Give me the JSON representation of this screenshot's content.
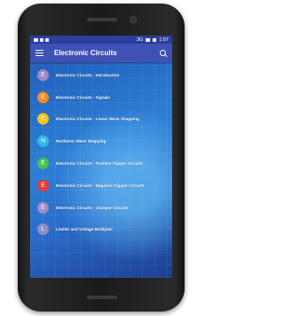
{
  "status_bar": {
    "signal_text": "3G",
    "time": "1:07"
  },
  "app_bar": {
    "title": "Electronic Circuits",
    "menu_icon": "menu-icon",
    "search_icon": "search-icon"
  },
  "items": [
    {
      "letter": "E",
      "label": "Electronic Circuits - Introduction",
      "color": "#9e86c9"
    },
    {
      "letter": "E",
      "label": "Electronic Circuits - Signals",
      "color": "#f48a24"
    },
    {
      "letter": "E",
      "label": "Electronic Circuits - Linear Wave Shapping",
      "color": "#f6c51e"
    },
    {
      "letter": "N",
      "label": "Nonlinear Wave Shapping",
      "color": "#33b9e0"
    },
    {
      "letter": "E",
      "label": "Electronic Circuits - Positive Clipper Circuits",
      "color": "#4bbd55"
    },
    {
      "letter": "E",
      "label": "Electronic Circuits - Negative Clipper Circuits",
      "color": "#e83b38"
    },
    {
      "letter": "E",
      "label": "Electronic Circuits - Clamper Circuits",
      "color": "#9b8fc6"
    },
    {
      "letter": "L",
      "label": "Limiter and Voltage Multiplier",
      "color": "#8d8fc7"
    }
  ]
}
